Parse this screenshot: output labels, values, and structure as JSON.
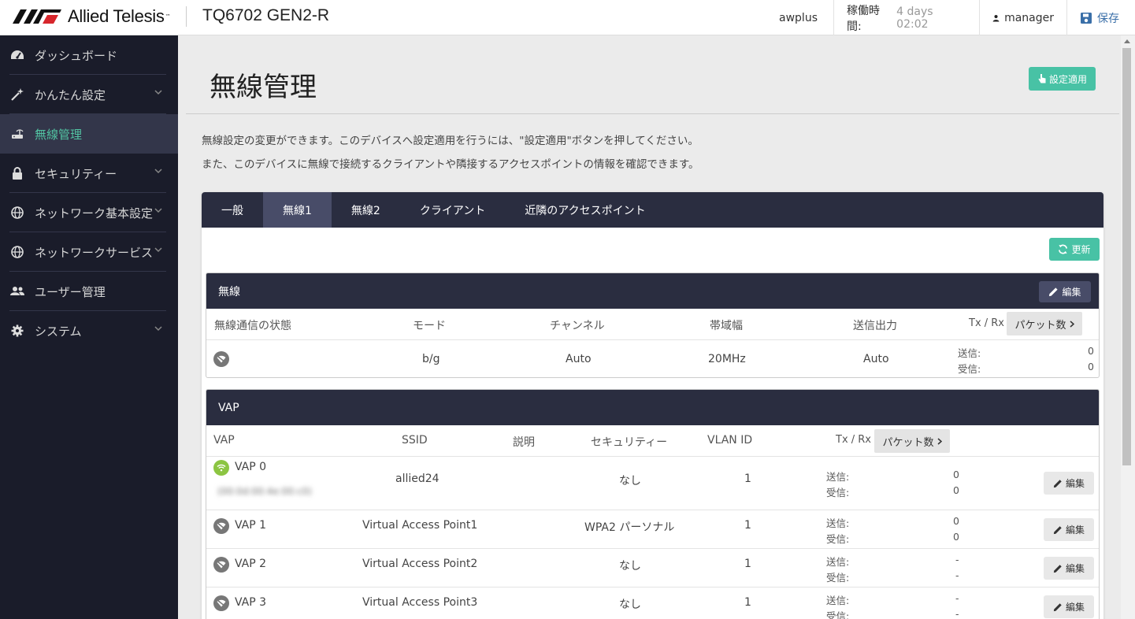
{
  "header": {
    "brand": "Allied Telesis",
    "device_name": "TQ6702 GEN2-R",
    "hostname": "awplus",
    "uptime_label": "稼働時間:",
    "uptime_value": "4 days 02:02",
    "user": "manager",
    "save_label": "保存"
  },
  "sidebar": {
    "items": [
      {
        "label": "ダッシュボード",
        "icon": "gauge-icon"
      },
      {
        "label": "かんたん設定",
        "icon": "magic-wand-icon"
      },
      {
        "label": "無線管理",
        "icon": "router-icon"
      },
      {
        "label": "セキュリティー",
        "icon": "lock-icon"
      },
      {
        "label": "ネットワーク基本設定",
        "icon": "globe-icon"
      },
      {
        "label": "ネットワークサービス",
        "icon": "globe-icon"
      },
      {
        "label": "ユーザー管理",
        "icon": "users-icon"
      },
      {
        "label": "システム",
        "icon": "gear-icon"
      }
    ]
  },
  "main": {
    "title": "無線管理",
    "apply_label": "設定適用",
    "desc1": "無線設定の変更ができます。このデバイスへ設定適用を行うには、\"設定適用\"ボタンを押してください。",
    "desc2": "また、このデバイスに無線で接続するクライアントや隣接するアクセスポイントの情報を確認できます。",
    "tabs": [
      "一般",
      "無線1",
      "無線2",
      "クライアント",
      "近隣のアクセスポイント"
    ],
    "refresh_label": "更新"
  },
  "radio": {
    "title": "無線",
    "edit_label": "編集",
    "headers": {
      "status": "無線通信の状態",
      "mode": "モード",
      "channel": "チャンネル",
      "bandwidth": "帯域幅",
      "power": "送信出力",
      "txrx": "Tx / Rx",
      "packets": "パケット数"
    },
    "row": {
      "mode": "b/g",
      "channel": "Auto",
      "bandwidth": "20MHz",
      "power": "Auto",
      "tx_label": "送信:",
      "tx": "0",
      "rx_label": "受信:",
      "rx": "0"
    }
  },
  "vap": {
    "title": "VAP",
    "headers": {
      "vap": "VAP",
      "ssid": "SSID",
      "desc": "説明",
      "security": "セキュリティー",
      "vlan": "VLAN ID",
      "txrx": "Tx / Rx",
      "packets": "パケット数"
    },
    "edit_label": "編集",
    "tx_label": "送信:",
    "rx_label": "受信:",
    "rows": [
      {
        "name": "VAP 0",
        "mac": "(00:0d:00:4e:00:c0)",
        "ssid": "allied24",
        "security": "なし",
        "vlan": "1",
        "tx": "0",
        "rx": "0",
        "enabled": true
      },
      {
        "name": "VAP 1",
        "ssid": "Virtual Access Point1",
        "security": "WPA2 パーソナル",
        "vlan": "1",
        "tx": "0",
        "rx": "0",
        "enabled": false
      },
      {
        "name": "VAP 2",
        "ssid": "Virtual Access Point2",
        "security": "なし",
        "vlan": "1",
        "tx": "-",
        "rx": "-",
        "enabled": false
      },
      {
        "name": "VAP 3",
        "ssid": "Virtual Access Point3",
        "security": "なし",
        "vlan": "1",
        "tx": "-",
        "rx": "-",
        "enabled": false
      }
    ]
  }
}
